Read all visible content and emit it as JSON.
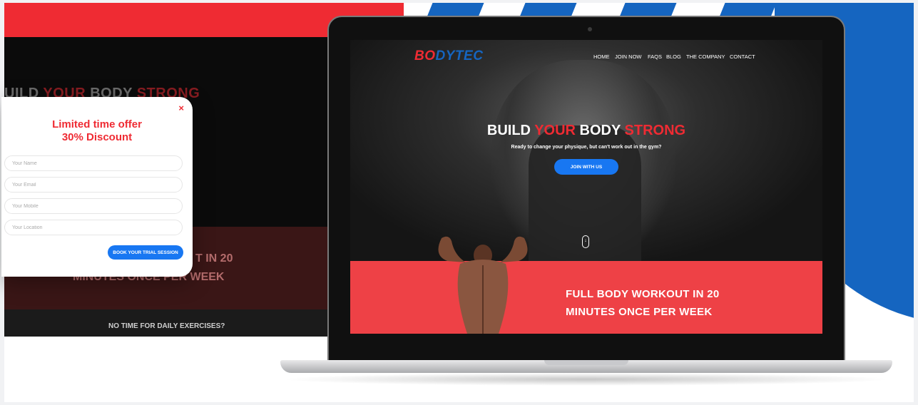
{
  "colors": {
    "red": "#ef2b33",
    "blue": "#1565c0",
    "accent_blue": "#1877f2",
    "section_red": "#ee4146",
    "bg_section_red": "#3a1616",
    "nav_text": "#ffffff"
  },
  "background_page": {
    "hero_title": {
      "part1": "UILD ",
      "part2": "YOUR",
      "part3": " BODY ",
      "part4": "STRONG"
    },
    "red_line1": "T IN 20",
    "red_line2": "MINUTES ONCE PER WEEK",
    "dark_text": "NO TIME FOR DAILY EXERCISES?"
  },
  "popup": {
    "close_icon": "×",
    "title_line1": "Limited time offer",
    "title_line2": "30% Discount",
    "fields": {
      "name_placeholder": "Your Name",
      "email_placeholder": "Your Email",
      "mobile_placeholder": "Your Mobile",
      "location_placeholder": "Your Location"
    },
    "submit_label": "BOOK YOUR TRIAL SESSION"
  },
  "site": {
    "logo": {
      "part1": "B",
      "part2": "O",
      "part3": "DYTEC"
    },
    "nav": [
      "HOME",
      "JOIN NOW",
      "FAQS",
      "BLOG",
      "THE COMPANY",
      "CONTACT"
    ],
    "hero_title": {
      "part1": "BUILD ",
      "part2": "YOUR",
      "part3": " BODY ",
      "part4": "STRONG"
    },
    "hero_subtitle": "Ready to change your physique, but can't work out in the gym?",
    "cta_label": "JOIN WITH US",
    "scroll_icon": "↓",
    "section_line1": "FULL BODY WORKOUT IN 20",
    "section_line2": "MINUTES ONCE PER WEEK"
  }
}
